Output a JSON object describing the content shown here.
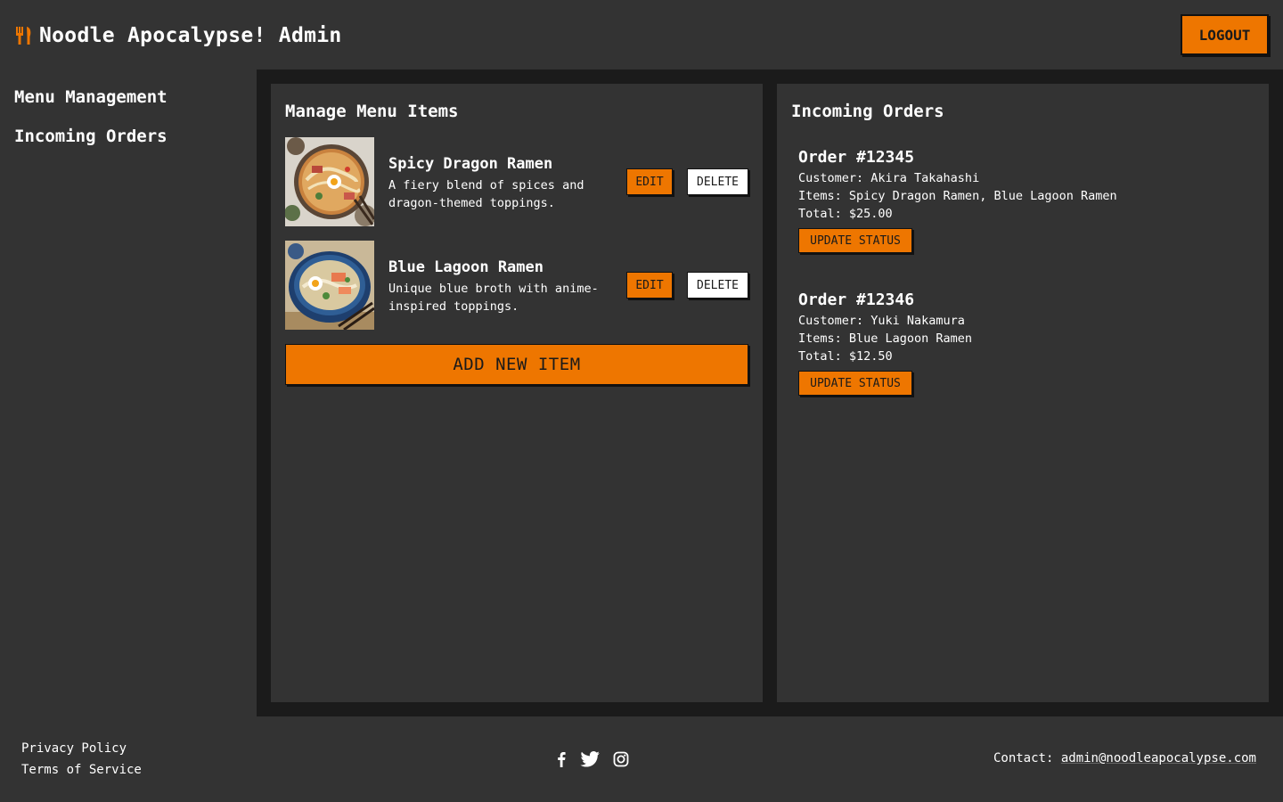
{
  "header": {
    "title": "Noodle Apocalypse! Admin",
    "logout_label": "LOGOUT"
  },
  "sidebar": {
    "items": [
      {
        "label": "Menu Management"
      },
      {
        "label": "Incoming Orders"
      }
    ]
  },
  "menu_panel": {
    "title": "Manage Menu Items",
    "items": [
      {
        "name": "Spicy Dragon Ramen",
        "description": "A fiery blend of spices and dragon-themed toppings.",
        "edit_label": "EDIT",
        "delete_label": "DELETE"
      },
      {
        "name": "Blue Lagoon Ramen",
        "description": "Unique blue broth with anime-inspired toppings.",
        "edit_label": "EDIT",
        "delete_label": "DELETE"
      }
    ],
    "add_label": "ADD NEW ITEM"
  },
  "orders_panel": {
    "title": "Incoming Orders",
    "orders": [
      {
        "title": "Order #12345",
        "customer": "Customer: Akira Takahashi",
        "items": "Items: Spicy Dragon Ramen, Blue Lagoon Ramen",
        "total": "Total: $25.00",
        "button_label": "UPDATE STATUS"
      },
      {
        "title": "Order #12346",
        "customer": "Customer: Yuki Nakamura",
        "items": "Items: Blue Lagoon Ramen",
        "total": "Total: $12.50",
        "button_label": "UPDATE STATUS"
      }
    ]
  },
  "footer": {
    "privacy_label": "Privacy Policy",
    "terms_label": "Terms of Service",
    "social_icons": [
      "facebook-icon",
      "twitter-icon",
      "instagram-icon"
    ],
    "contact_prefix": "Contact:",
    "contact_email": "admin@noodleapocalypse.com"
  },
  "colors": {
    "background": "#333333",
    "main_background": "#1b1b1b",
    "accent": "#ee7600",
    "text": "#ffffff"
  }
}
